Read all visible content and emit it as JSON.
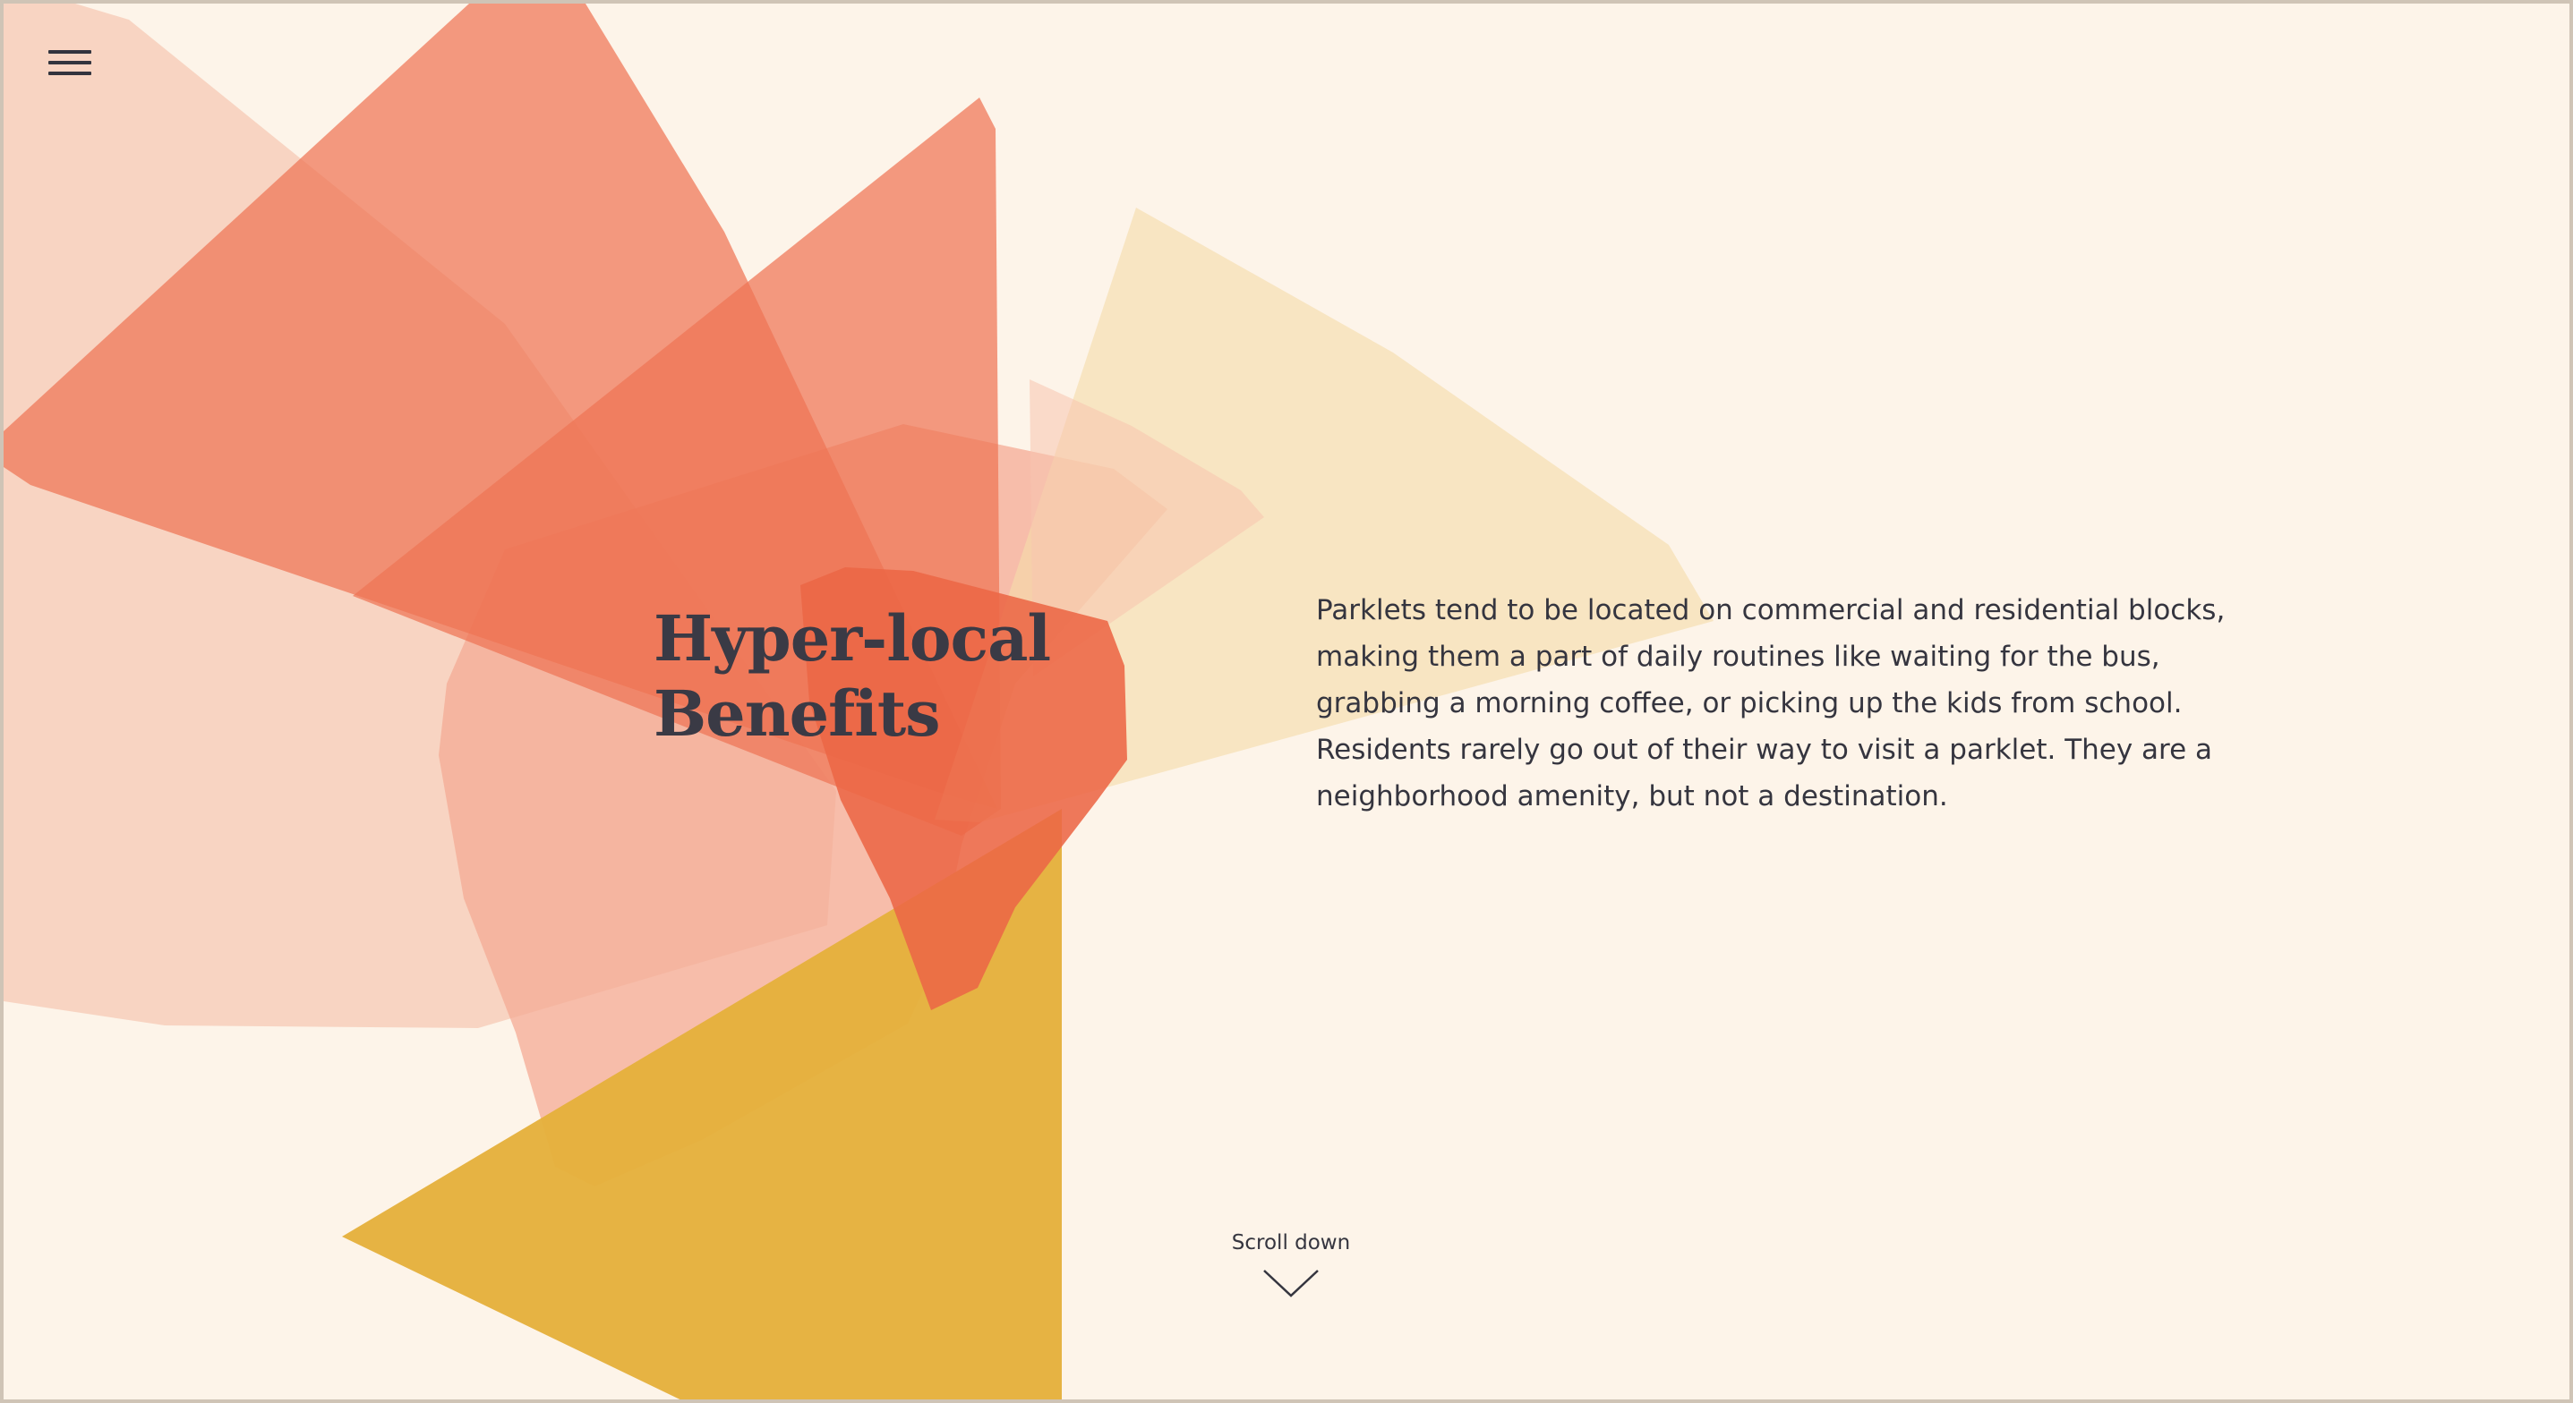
{
  "menu": {
    "icon": "hamburger-menu-icon"
  },
  "hero": {
    "title_line1": "Hyper-local",
    "title_line2": "Benefits",
    "body": "Parklets tend to be located on commercial and residential blocks, making them a part of daily routines like waiting for the bus, grabbing a morning coffee, or picking up the kids from school. Residents rarely go out of their way to visit a parklet. They are a neighborhood amenity, but not a destination."
  },
  "scroll": {
    "label": "Scroll down",
    "icon": "chevron-down-icon"
  },
  "colors": {
    "background": "#fdf4e9",
    "coral": "#ec6a4e",
    "light_coral": "#f5a88e",
    "peach": "#f8d2c0",
    "sand": "#f6dfb2",
    "mustard": "#e5b13d",
    "text": "#35353f"
  }
}
